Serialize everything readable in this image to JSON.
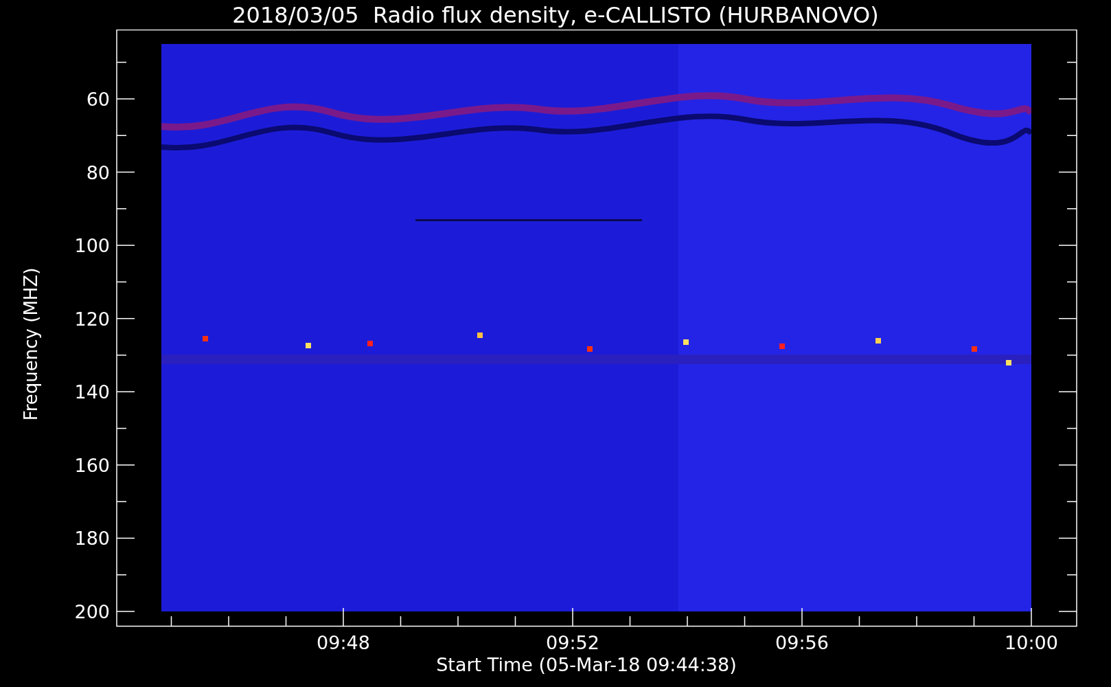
{
  "title": "2018/03/05  Radio flux density, e-CALLISTO (HURBANOVO)",
  "y_axis": {
    "label": "Frequency (MHZ)",
    "ticks": [
      "60",
      "80",
      "100",
      "120",
      "140",
      "160",
      "180",
      "200"
    ]
  },
  "x_axis": {
    "label": "Start Time (05-Mar-18 09:44:38)",
    "ticks": [
      "09:48",
      "09:52",
      "09:56",
      "10:00"
    ]
  }
}
